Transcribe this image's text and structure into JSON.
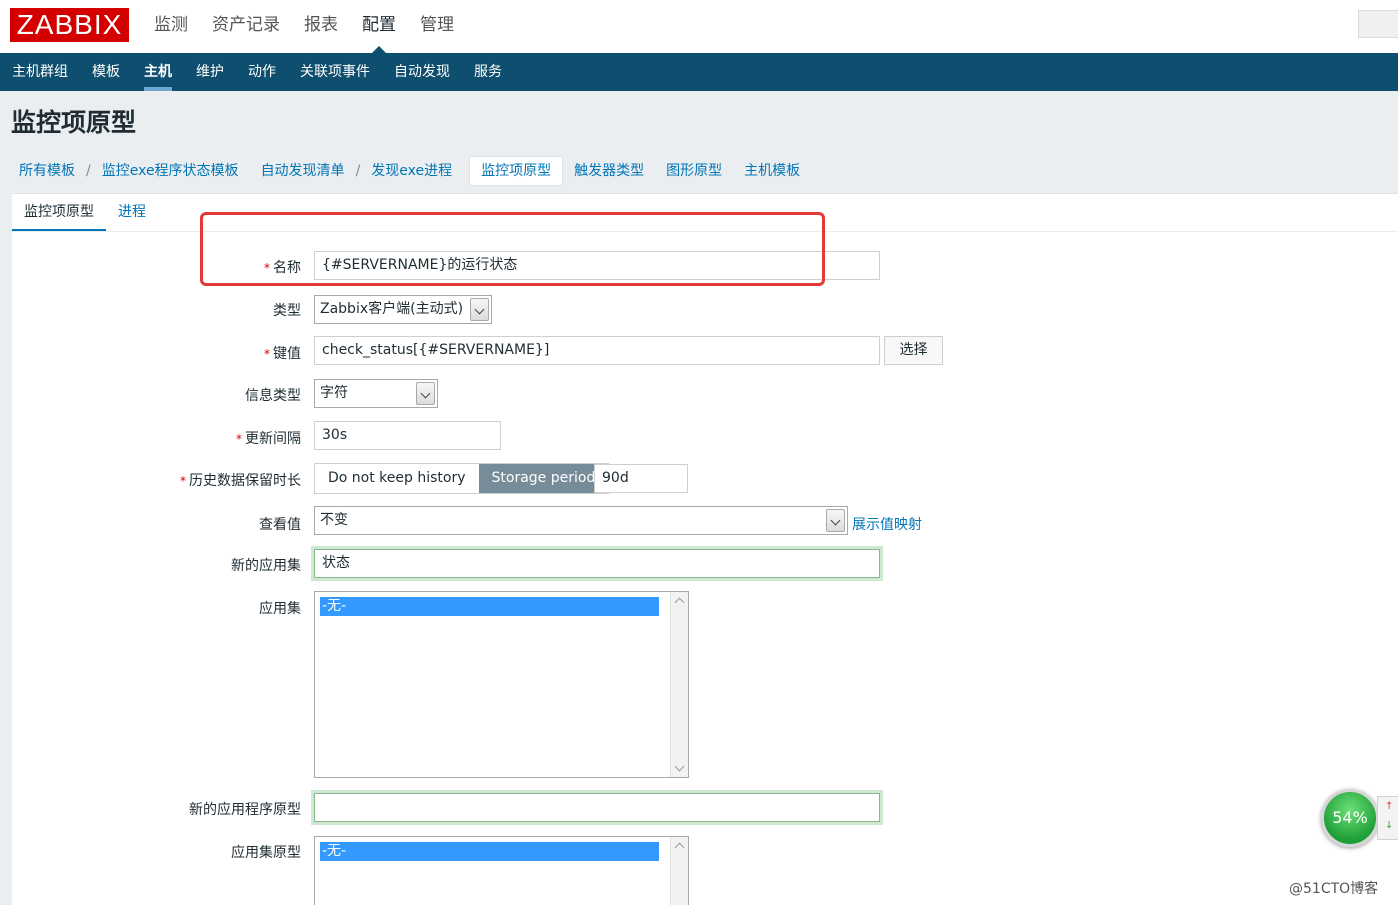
{
  "header": {
    "logo": "ZABBIX",
    "menu": [
      "监测",
      "资产记录",
      "报表",
      "配置",
      "管理"
    ],
    "active_menu": "配置"
  },
  "subnav": {
    "items": [
      "主机群组",
      "模板",
      "主机",
      "维护",
      "动作",
      "关联项事件",
      "自动发现",
      "服务"
    ],
    "active": "主机"
  },
  "page_title": "监控项原型",
  "breadcrumb": {
    "items": [
      "所有模板",
      "监控exe程序状态模板",
      "自动发现清单",
      "发现exe进程",
      "监控项原型",
      "触发器类型",
      "图形原型",
      "主机模板"
    ],
    "separator": "/"
  },
  "tabs": [
    "监控项原型",
    "进程"
  ],
  "form": {
    "name_label": "名称",
    "name_value": "{#SERVERNAME}的运行状态",
    "type_label": "类型",
    "type_value": "Zabbix客户端(主动式)",
    "key_label": "键值",
    "key_value": "check_status[{#SERVERNAME}]",
    "select_button": "选择",
    "info_type_label": "信息类型",
    "info_type_value": "字符",
    "interval_label": "更新间隔",
    "interval_value": "30s",
    "history_label": "历史数据保留时长",
    "history_opt1": "Do not keep history",
    "history_opt2": "Storage period",
    "history_value": "90d",
    "valuemap_label": "查看值",
    "valuemap_value": "不变",
    "valuemap_link": "展示值映射",
    "new_app_label": "新的应用集",
    "new_app_value": "状态",
    "apps_label": "应用集",
    "apps_option": "-无-",
    "new_app_proto_label": "新的应用程序原型",
    "new_app_proto_value": "",
    "app_proto_label": "应用集原型",
    "app_proto_option": "-无-",
    "required_mark": "*"
  },
  "overlay": {
    "gauge_value": "54%",
    "arrow_up": "↑",
    "arrow_down": "↓",
    "watermark": "@51CTO博客"
  },
  "colors": {
    "brand_red": "#d40000",
    "nav_blue": "#0e4e6e",
    "link_blue": "#0275b8",
    "highlight_box": "#e53935"
  }
}
